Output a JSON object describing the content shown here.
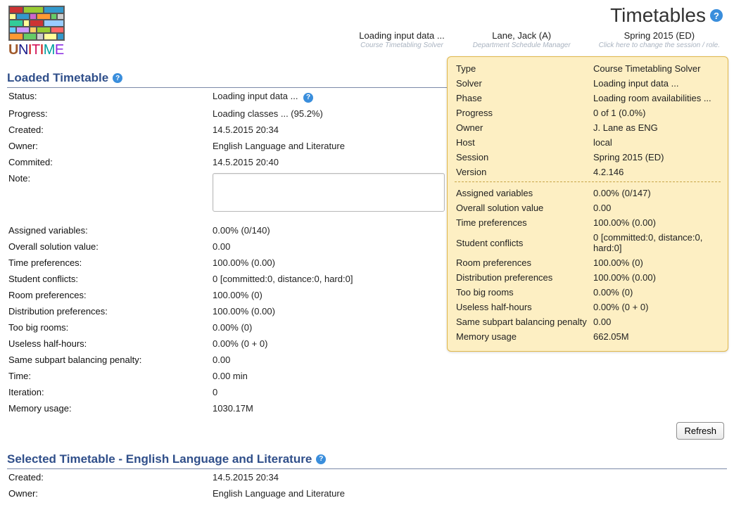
{
  "page_title": "Timetables",
  "crumbs": {
    "left": {
      "main": "Loading input data ...",
      "sub": "Course Timetabling Solver"
    },
    "center": {
      "main": "Lane, Jack (A)",
      "sub": "Department Schedule Manager"
    },
    "right": {
      "main": "Spring 2015 (ED)",
      "sub": "Click here to change the session / role."
    }
  },
  "section1_title": "Loaded Timetable",
  "loaded": {
    "status_lbl": "Status:",
    "status_val": "Loading input data ...",
    "progress_lbl": "Progress:",
    "progress_val": "Loading classes ... (95.2%)",
    "created_lbl": "Created:",
    "created_val": "14.5.2015 20:34",
    "owner_lbl": "Owner:",
    "owner_val": "English Language and Literature",
    "committed_lbl": "Commited:",
    "committed_val": "14.5.2015 20:40",
    "note_lbl": "Note:",
    "av_lbl": "Assigned variables:",
    "av_val": "0.00% (0/140)",
    "osv_lbl": "Overall solution value:",
    "osv_val": "0.00",
    "tp_lbl": "Time preferences:",
    "tp_val": "100.00% (0.00)",
    "sc_lbl": "Student conflicts:",
    "sc_val": "0 [committed:0, distance:0, hard:0]",
    "rp_lbl": "Room preferences:",
    "rp_val": "100.00% (0)",
    "dp_lbl": "Distribution preferences:",
    "dp_val": "100.00% (0.00)",
    "tbr_lbl": "Too big rooms:",
    "tbr_val": "0.00% (0)",
    "uhh_lbl": "Useless half-hours:",
    "uhh_val": "0.00% (0 + 0)",
    "ssbp_lbl": "Same subpart balancing penalty:",
    "ssbp_val": "0.00",
    "time_lbl": "Time:",
    "time_val": "0.00 min",
    "iter_lbl": "Iteration:",
    "iter_val": "0",
    "mem_lbl": "Memory usage:",
    "mem_val": "1030.17M"
  },
  "refresh_label": "Refresh",
  "section2_title": "Selected Timetable - English Language and Literature",
  "selected": {
    "created_lbl": "Created:",
    "created_val": "14.5.2015 20:34",
    "owner_lbl": "Owner:",
    "owner_val": "English Language and Literature"
  },
  "tooltip": {
    "type_k": "Type",
    "type_v": "Course Timetabling Solver",
    "solver_k": "Solver",
    "solver_v": "Loading input data ...",
    "phase_k": "Phase",
    "phase_v": "Loading room availabilities ...",
    "prog_k": "Progress",
    "prog_v": "0 of 1 (0.0%)",
    "owner_k": "Owner",
    "owner_v": "J. Lane as ENG",
    "host_k": "Host",
    "host_v": "local",
    "sess_k": "Session",
    "sess_v": "Spring 2015 (ED)",
    "ver_k": "Version",
    "ver_v": "4.2.146",
    "av_k": "Assigned variables",
    "av_v": "0.00% (0/147)",
    "osv_k": "Overall solution value",
    "osv_v": "0.00",
    "tp_k": "Time preferences",
    "tp_v": "100.00% (0.00)",
    "sc_k": "Student conflicts",
    "sc_v": "0 [committed:0, distance:0, hard:0]",
    "rp_k": "Room preferences",
    "rp_v": "100.00% (0)",
    "dp_k": "Distribution preferences",
    "dp_v": "100.00% (0.00)",
    "tbr_k": "Too big rooms",
    "tbr_v": "0.00% (0)",
    "uhh_k": "Useless half-hours",
    "uhh_v": "0.00% (0 + 0)",
    "ssbp_k": "Same subpart balancing penalty",
    "ssbp_v": "0.00",
    "mem_k": "Memory usage",
    "mem_v": "662.05M"
  }
}
